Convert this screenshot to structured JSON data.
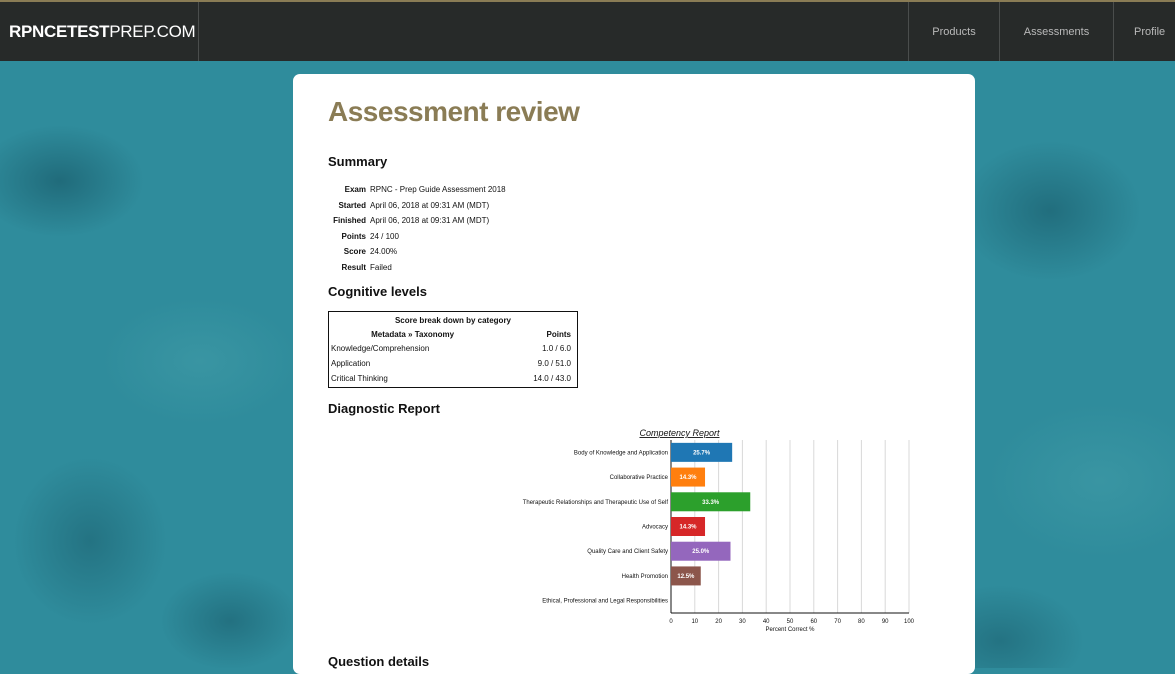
{
  "header": {
    "logo_bold": "RPNCETEST",
    "logo_rest": "PREP.COM",
    "nav": [
      {
        "label": "Products"
      },
      {
        "label": "Assessments"
      },
      {
        "label": "Profile"
      }
    ]
  },
  "page": {
    "title": "Assessment review",
    "summary_heading": "Summary",
    "summary": [
      {
        "label": "Exam",
        "value": "RPNC - Prep Guide Assessment 2018"
      },
      {
        "label": "Started",
        "value": "April 06, 2018 at 09:31 AM (MDT)"
      },
      {
        "label": "Finished",
        "value": "April 06, 2018 at 09:31 AM (MDT)"
      },
      {
        "label": "Points",
        "value": "24 / 100"
      },
      {
        "label": "Score",
        "value": "24.00%"
      },
      {
        "label": "Result",
        "value": "Failed"
      }
    ],
    "cognitive_heading": "Cognitive levels",
    "cognitive_table": {
      "caption": "Score break down by category",
      "col1": "Metadata » Taxonomy",
      "col2": "Points",
      "rows": [
        {
          "name": "Knowledge/Comprehension",
          "points": "1.0 / 6.0"
        },
        {
          "name": "Application",
          "points": "9.0 / 51.0"
        },
        {
          "name": "Critical Thinking",
          "points": "14.0 / 43.0"
        }
      ]
    },
    "diagnostic_heading": "Diagnostic Report",
    "question_heading": "Question details"
  },
  "chart_data": {
    "type": "bar",
    "orientation": "horizontal",
    "title": "Competency Report",
    "xlabel": "Percent Correct %",
    "xlim": [
      0,
      100
    ],
    "xticks": [
      0,
      10,
      20,
      30,
      40,
      50,
      60,
      70,
      80,
      90,
      100
    ],
    "grid": true,
    "categories": [
      "Body of Knowledge and Application",
      "Collaborative Practice",
      "Therapeutic Relationships and Therapeutic Use of Self",
      "Advocacy",
      "Quality Care and Client Safety",
      "Health Promotion",
      "Ethical, Professional and Legal Responsibilities"
    ],
    "values": [
      25.7,
      14.3,
      33.3,
      14.3,
      25.0,
      12.5,
      0
    ],
    "labels": [
      "25.7%",
      "14.3%",
      "33.3%",
      "14.3%",
      "25.0%",
      "12.5%",
      ""
    ],
    "colors": [
      "#1f77b4",
      "#ff7f0e",
      "#2ca02c",
      "#d62728",
      "#9467bd",
      "#8c564b",
      "#e377c2"
    ]
  }
}
